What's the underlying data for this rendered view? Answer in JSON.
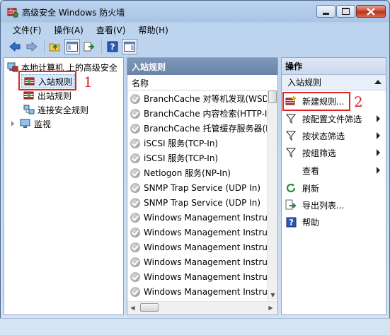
{
  "window": {
    "title": "高级安全 Windows 防火墙",
    "controls": {
      "minimize": "minimize-icon",
      "maximize": "maximize-icon",
      "close": "close-icon"
    }
  },
  "menu": [
    "文件(F)",
    "操作(A)",
    "查看(V)",
    "帮助(H)"
  ],
  "toolbar": {
    "icons": [
      "back-arrow-icon",
      "forward-arrow-icon",
      "up-folder-icon",
      "show-hide-tree-icon",
      "export-icon",
      "help-icon",
      "show-hide-action-pane-icon"
    ]
  },
  "tree": {
    "root": "本地计算机 上的高级安全",
    "items": [
      "入站规则",
      "出站规则",
      "连接安全规则",
      "监视"
    ]
  },
  "rules_pane": {
    "header": "入站规则",
    "column": "名称",
    "rows": [
      "BranchCache 对等机发现(WSD",
      "BranchCache 内容检索(HTTP-In",
      "BranchCache 托管缓存服务器(H",
      "iSCSI 服务(TCP-In)",
      "iSCSI 服务(TCP-In)",
      "Netlogon 服务(NP-In)",
      "SNMP Trap Service (UDP In)",
      "SNMP Trap Service (UDP In)",
      "Windows Management Instru",
      "Windows Management Instru",
      "Windows Management Instru",
      "Windows Management Instru",
      "Windows Management Instru",
      "Windows Management Instru"
    ]
  },
  "actions_pane": {
    "header": "操作",
    "section": "入站规则",
    "items": [
      {
        "label": "新建规则...",
        "icon": "new-rule-icon",
        "submenu": false
      },
      {
        "label": "按配置文件筛选",
        "icon": "filter-icon",
        "submenu": true
      },
      {
        "label": "按状态筛选",
        "icon": "filter-icon",
        "submenu": true
      },
      {
        "label": "按组筛选",
        "icon": "filter-icon",
        "submenu": true
      },
      {
        "label": "查看",
        "icon": "",
        "submenu": true
      },
      {
        "label": "刷新",
        "icon": "refresh-icon",
        "submenu": false
      },
      {
        "label": "导出列表...",
        "icon": "export-list-icon",
        "submenu": false
      },
      {
        "label": "帮助",
        "icon": "help-icon",
        "submenu": false
      }
    ]
  },
  "annotations": {
    "marker_1": "1",
    "marker_2": "2",
    "color": "#e32222"
  }
}
